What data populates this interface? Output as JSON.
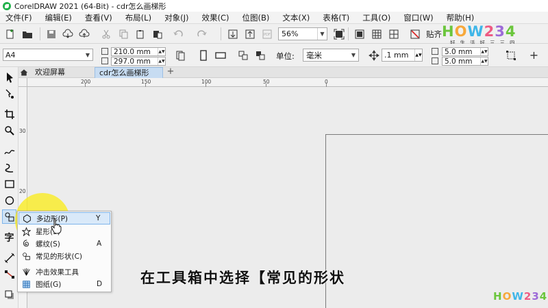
{
  "window": {
    "title": "CorelDRAW 2021 (64-Bit) - cdr怎么画梯形"
  },
  "menu": [
    "文件(F)",
    "编辑(E)",
    "查看(V)",
    "布局(L)",
    "对象(J)",
    "效果(C)",
    "位图(B)",
    "文本(X)",
    "表格(T)",
    "工具(O)",
    "窗口(W)",
    "帮助(H)"
  ],
  "toolbar": {
    "zoom_value": "56%",
    "snap_label": "贴齐"
  },
  "property_bar": {
    "page_size": "A4",
    "width": "210.0 mm",
    "height": "297.0 mm",
    "unit_label": "单位:",
    "unit_value": "毫米",
    "nudge": ".1 mm",
    "dup_x": "5.0 mm",
    "dup_y": "5.0 mm"
  },
  "tabs": {
    "welcome": "欢迎屏幕",
    "document": "cdr怎么画梯形"
  },
  "ruler": {
    "h_labels": [
      "200",
      "150",
      "100",
      "50",
      "0"
    ],
    "v_labels": [
      "30",
      "20"
    ]
  },
  "toolbox": {
    "text_tool": "字"
  },
  "flyout": {
    "items": [
      {
        "label": "多边形(P)",
        "shortcut": "Y",
        "icon": "polygon-icon"
      },
      {
        "label": "星形(S)",
        "shortcut": "",
        "icon": "star-icon"
      },
      {
        "label": "螺纹(S)",
        "shortcut": "A",
        "icon": "spiral-icon"
      },
      {
        "label": "常见的形状(C)",
        "shortcut": "",
        "icon": "common-shapes-icon"
      },
      {
        "label": "冲击效果工具",
        "shortcut": "",
        "icon": "impact-effect-icon"
      },
      {
        "label": "图纸(G)",
        "shortcut": "D",
        "icon": "graph-paper-icon"
      }
    ]
  },
  "subtitle": "在工具箱中选择【常见的形状",
  "watermark": {
    "logo": "HOW234",
    "sub": "好生活好三三四"
  },
  "colors": {
    "highlight": "#f5e71a",
    "active_tab": "#c7dcf2",
    "hover": "#d9e9f9"
  }
}
